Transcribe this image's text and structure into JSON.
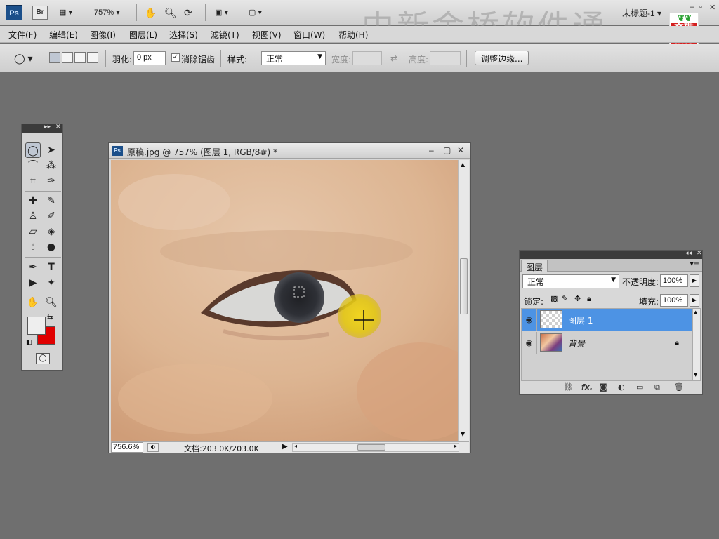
{
  "app": {
    "logo_text": "Ps",
    "bridge_text": "Br",
    "zoom_menu": "757%",
    "doc_title": "未标题-1",
    "window_controls": [
      "‒",
      "▫",
      "✕"
    ],
    "watermark": "中新金桥软件通",
    "badge_top": "YY",
    "badge_text": "育碟\n教育"
  },
  "menu": [
    "文件(F)",
    "编辑(E)",
    "图像(I)",
    "图层(L)",
    "选择(S)",
    "滤镜(T)",
    "视图(V)",
    "窗口(W)",
    "帮助(H)"
  ],
  "options": {
    "feather_label": "羽化:",
    "feather_value": "0 px",
    "antialias_label": "消除锯齿",
    "antialias_checked": "✓",
    "style_label": "样式:",
    "style_value": "正常",
    "width_label": "宽度:",
    "height_label": "高度:",
    "refine_button": "调整边缘..."
  },
  "document": {
    "title": "原稿.jpg @ 757% (图层 1, RGB/8#) *",
    "zoom": "756.6%",
    "doc_size": "文档:203.0K/203.0K"
  },
  "layers_panel": {
    "tab": "图层",
    "blend_mode": "正常",
    "opacity_label": "不透明度:",
    "opacity_value": "100%",
    "lock_label": "锁定:",
    "fill_label": "填充:",
    "fill_value": "100%",
    "layers": [
      {
        "name": "图层 1",
        "selected": true
      },
      {
        "name": "背景",
        "selected": false
      }
    ],
    "footer_icons": [
      "link-icon",
      "fx-icon",
      "mask-icon",
      "adjustment-icon",
      "group-icon",
      "new-layer-icon",
      "trash-icon"
    ]
  },
  "colors": {
    "foreground": "#eeeeee",
    "background": "#e00000",
    "selected_layer": "#4d93e4",
    "brush_highlight": "#e8d21a"
  }
}
